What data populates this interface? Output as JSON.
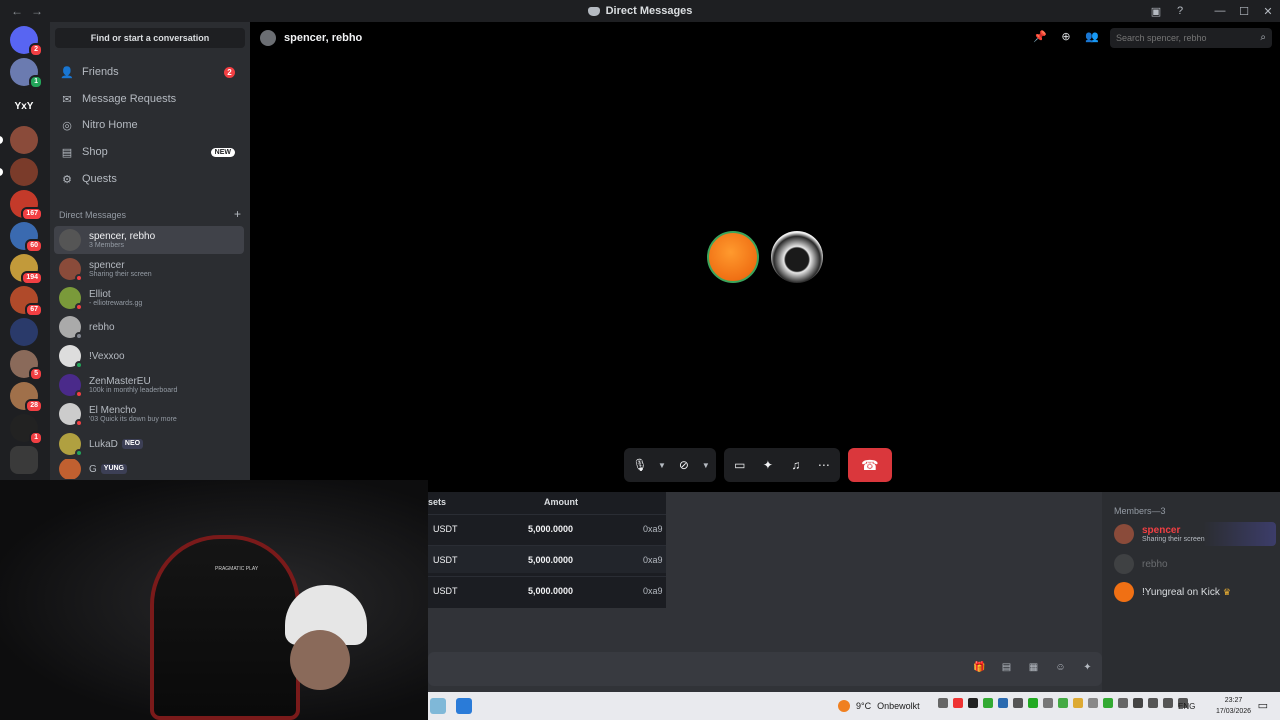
{
  "window": {
    "title": "Direct Messages",
    "icons": [
      "back-arrow-icon",
      "forward-arrow-icon",
      "inbox-icon",
      "help-icon",
      "minimize-icon",
      "maximize-icon",
      "close-icon"
    ]
  },
  "server_rail": {
    "servers": [
      {
        "name": "discord-home",
        "badge": "2",
        "color": "#5865f2"
      },
      {
        "name": "server-2",
        "badge": "1",
        "color": "#6b7bb0"
      },
      {
        "name": "server-yxy",
        "label": "YxY",
        "badge": "",
        "color": "#1e1f22"
      },
      {
        "name": "server-4",
        "badge": "",
        "color": "#8a4b3a"
      },
      {
        "name": "server-5",
        "badge": "",
        "color": "#7a3b2a"
      },
      {
        "name": "server-6",
        "badge": "167",
        "color": "#c43a2a"
      },
      {
        "name": "server-7",
        "badge": "60",
        "color": "#3a6ab0"
      },
      {
        "name": "server-8",
        "badge": "194",
        "color": "#c29a3a"
      },
      {
        "name": "server-9",
        "badge": "67",
        "color": "#b04a2a"
      },
      {
        "name": "server-10",
        "badge": "",
        "color": "#2a3a6a"
      },
      {
        "name": "server-11",
        "badge": "5",
        "color": "#8a6a5a"
      },
      {
        "name": "server-12",
        "badge": "28",
        "color": "#a0704a"
      },
      {
        "name": "server-13",
        "badge": "1",
        "color": "#222"
      },
      {
        "name": "server-14",
        "badge": "",
        "color": "#3a3a3a"
      }
    ]
  },
  "sidebar": {
    "find_label": "Find or start a conversation",
    "nav": [
      {
        "label": "Friends",
        "icon": "friends-icon",
        "count": "2"
      },
      {
        "label": "Message Requests",
        "icon": "mail-icon"
      },
      {
        "label": "Nitro Home",
        "icon": "nitro-icon"
      },
      {
        "label": "Shop",
        "icon": "shop-icon",
        "tag": "NEW"
      },
      {
        "label": "Quests",
        "icon": "quests-icon"
      }
    ],
    "dm_header": "Direct Messages",
    "dms": [
      {
        "name": "spencer, rebho",
        "sub": "3 Members",
        "color": "#555",
        "status": ""
      },
      {
        "name": "spencer",
        "sub": "Sharing their screen",
        "color": "#8a4b3a",
        "status": "#f23f43"
      },
      {
        "name": "Elliot",
        "sub": "- elliotrewards.gg",
        "color": "#7a9a3a",
        "status": "#f23f43"
      },
      {
        "name": "rebho",
        "sub": "",
        "color": "#aaa",
        "status": "#80848e"
      },
      {
        "name": "!Vexxoo",
        "sub": "",
        "color": "#ddd",
        "status": "#23a55a"
      },
      {
        "name": "ZenMasterEU",
        "sub": "100k in monthly leaderboard",
        "color": "#4a2a8a",
        "status": "#f23f43"
      },
      {
        "name": "El Mencho",
        "sub": "'03 Quick its down buy more",
        "color": "#ccc",
        "status": "#f23f43"
      },
      {
        "name": "LukaD",
        "sub": "",
        "tag": "NEO",
        "color": "#b0a040",
        "status": "#23a55a"
      },
      {
        "name": "G",
        "sub": "",
        "tag": "YUNG",
        "color": "#c06030",
        "status": ""
      }
    ]
  },
  "call": {
    "title": "spencer, rebho",
    "search_placeholder": "Search spencer, rebho",
    "header_icons": [
      "pin-icon",
      "add-friend-icon",
      "members-icon"
    ]
  },
  "table": {
    "headers": [
      "sets",
      "Amount"
    ],
    "rows": [
      {
        "asset": "USDT",
        "amount": "5,000.0000",
        "addr": "0xa9"
      },
      {
        "asset": "USDT",
        "amount": "5,000.0000",
        "addr": "0xa9"
      },
      {
        "asset": "USDT",
        "amount": "5,000.0000",
        "addr": "0xa9"
      }
    ]
  },
  "members": {
    "title": "Members—3",
    "list": [
      {
        "name": "spencer",
        "sub": "Sharing their screen",
        "color": "#8a4b3a"
      },
      {
        "name": "rebho",
        "sub": "",
        "color": "#666"
      },
      {
        "name": "!Yungreal on Kick",
        "sub": "",
        "color": "#f07014"
      }
    ]
  },
  "webcam": {
    "chair_text": "PRAGMATIC PLAY"
  },
  "taskbar": {
    "weather": "9°C",
    "weather_desc": "Onbewolkt",
    "lang": "ENG",
    "time": "23:27",
    "date": "17/03/2026"
  }
}
